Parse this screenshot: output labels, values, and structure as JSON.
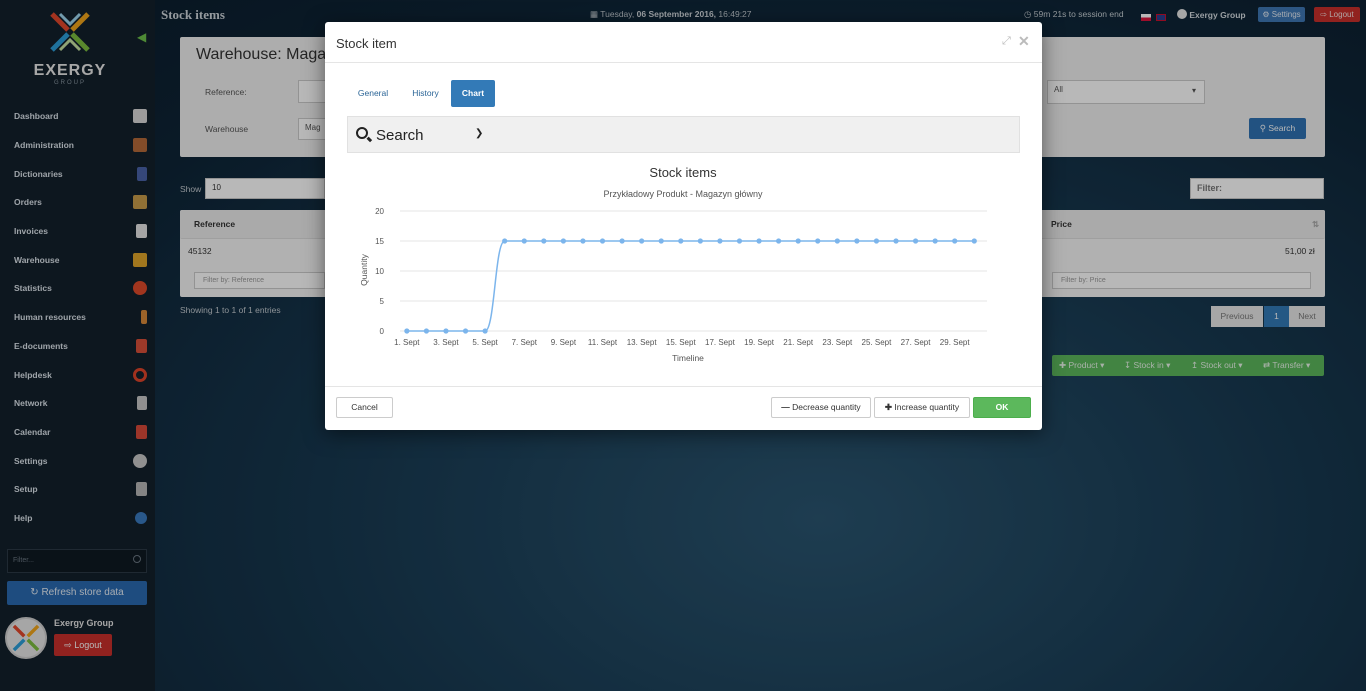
{
  "topbar": {
    "page_title": "Stock items",
    "datetime_prefix": "Tuesday,",
    "datetime_date": "06 September 2016,",
    "datetime_time": "16:49:27",
    "session": "59m 21s to session end",
    "company": "Exergy Group",
    "settings_label": "Settings",
    "logout_label": "Logout"
  },
  "sidebar": {
    "logo_text": "EXERGY",
    "logo_sub": "GROUP",
    "items": [
      {
        "label": "Dashboard",
        "icon": "home-icon",
        "color": "#d8d8d8"
      },
      {
        "label": "Administration",
        "icon": "books-icon",
        "color": "#b56a3a"
      },
      {
        "label": "Dictionaries",
        "icon": "dictionary-icon",
        "color": "#4a63a8"
      },
      {
        "label": "Orders",
        "icon": "box-icon",
        "color": "#c89b4a"
      },
      {
        "label": "Invoices",
        "icon": "invoice-icon",
        "color": "#e5e5e5"
      },
      {
        "label": "Warehouse",
        "icon": "forklift-icon",
        "color": "#e0a52a"
      },
      {
        "label": "Statistics",
        "icon": "pie-chart-icon",
        "color": "#e04a2a"
      },
      {
        "label": "Human resources",
        "icon": "person-icon",
        "color": "#d9893a"
      },
      {
        "label": "E-documents",
        "icon": "pdf-icon",
        "color": "#d9503a"
      },
      {
        "label": "Helpdesk",
        "icon": "lifebuoy-icon",
        "color": "#e0442a"
      },
      {
        "label": "Network",
        "icon": "network-icon",
        "color": "#c8c8c8"
      },
      {
        "label": "Calendar",
        "icon": "calendar-icon",
        "color": "#d94a3a"
      },
      {
        "label": "Settings",
        "icon": "gear-icon",
        "color": "#c8c8c8"
      },
      {
        "label": "Setup",
        "icon": "setup-icon",
        "color": "#b8b8b8"
      },
      {
        "label": "Help",
        "icon": "help-icon",
        "color": "#3a7ac0"
      }
    ],
    "filter_placeholder": "Filter...",
    "refresh_label": "Refresh store data",
    "user_name": "Exergy Group",
    "logout_label": "Logout"
  },
  "background": {
    "warehouse_title": "Warehouse: Magaz",
    "reference_label": "Reference:",
    "warehouse_label": "Warehouse",
    "warehouse_value": "Mag",
    "select_value": "All",
    "search_label": "Search",
    "show_label": "Show",
    "show_value": "10",
    "filter_label": "Filter:",
    "col_reference": "Reference",
    "col_price": "Price",
    "row_reference": "45132",
    "row_price": "51,00 zł",
    "filter_reference": "Filter by: Reference",
    "filter_price": "Filter by: Price",
    "showing": "Showing 1 to 1 of 1 entries",
    "previous": "Previous",
    "page": "1",
    "next": "Next",
    "actions": [
      "Product",
      "Stock in",
      "Stock out",
      "Transfer"
    ]
  },
  "modal": {
    "title": "Stock item",
    "tabs": [
      "General",
      "History",
      "Chart"
    ],
    "active_tab": "Chart",
    "search_label": "Search",
    "cancel_label": "Cancel",
    "decrease_label": "Decrease quantity",
    "increase_label": "Increase quantity",
    "ok_label": "OK"
  },
  "chart_data": {
    "type": "line",
    "title": "Stock items",
    "subtitle": "Przykładowy Produkt - Magazyn główny",
    "xlabel": "Timeline",
    "ylabel": "Quantity",
    "ylim": [
      0,
      20
    ],
    "yticks": [
      0,
      5,
      10,
      15,
      20
    ],
    "xtick_labels": [
      "1. Sept",
      "3. Sept",
      "5. Sept",
      "7. Sept",
      "9. Sept",
      "11. Sept",
      "13. Sept",
      "15. Sept",
      "17. Sept",
      "19. Sept",
      "21. Sept",
      "23. Sept",
      "25. Sept",
      "27. Sept",
      "29. Sept"
    ],
    "x": [
      1,
      2,
      3,
      4,
      5,
      6,
      7,
      8,
      9,
      10,
      11,
      12,
      13,
      14,
      15,
      16,
      17,
      18,
      19,
      20,
      21,
      22,
      23,
      24,
      25,
      26,
      27,
      28,
      29,
      30
    ],
    "series": [
      {
        "values": [
          0,
          0,
          0,
          0,
          0,
          15,
          15,
          15,
          15,
          15,
          15,
          15,
          15,
          15,
          15,
          15,
          15,
          15,
          15,
          15,
          15,
          15,
          15,
          15,
          15,
          15,
          15,
          15,
          15,
          15
        ]
      }
    ],
    "grid": true,
    "color": "#7cb5ec"
  }
}
